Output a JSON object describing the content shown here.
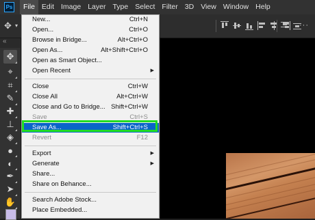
{
  "app": {
    "logo_text": "Ps"
  },
  "menubar": {
    "items": [
      "File",
      "Edit",
      "Image",
      "Layer",
      "Type",
      "Select",
      "Filter",
      "3D",
      "View",
      "Window",
      "Help"
    ]
  },
  "file_menu": {
    "groups": [
      [
        {
          "label": "New...",
          "shortcut": "Ctrl+N"
        },
        {
          "label": "Open...",
          "shortcut": "Ctrl+O"
        },
        {
          "label": "Browse in Bridge...",
          "shortcut": "Alt+Ctrl+O"
        },
        {
          "label": "Open As...",
          "shortcut": "Alt+Shift+Ctrl+O"
        },
        {
          "label": "Open as Smart Object...",
          "shortcut": ""
        },
        {
          "label": "Open Recent",
          "shortcut": "",
          "submenu": true
        }
      ],
      [
        {
          "label": "Close",
          "shortcut": "Ctrl+W"
        },
        {
          "label": "Close All",
          "shortcut": "Alt+Ctrl+W"
        },
        {
          "label": "Close and Go to Bridge...",
          "shortcut": "Shift+Ctrl+W"
        },
        {
          "label": "Save",
          "shortcut": "Ctrl+S",
          "disabled": true
        },
        {
          "label": "Save As...",
          "shortcut": "Shift+Ctrl+S",
          "highlighted": true
        },
        {
          "label": "Revert",
          "shortcut": "F12",
          "disabled": true
        }
      ],
      [
        {
          "label": "Export",
          "shortcut": "",
          "submenu": true
        },
        {
          "label": "Generate",
          "shortcut": "",
          "submenu": true
        },
        {
          "label": "Share...",
          "shortcut": ""
        },
        {
          "label": "Share on Behance...",
          "shortcut": ""
        }
      ],
      [
        {
          "label": "Search Adobe Stock...",
          "shortcut": ""
        },
        {
          "label": "Place Embedded...",
          "shortcut": ""
        }
      ]
    ]
  },
  "toolbar": {
    "tools": [
      "move-tool",
      "marquee-tool",
      "crop-tool",
      "eyedropper-tool",
      "healing-brush-tool",
      "clone-stamp-tool",
      "eraser-tool",
      "blur-tool",
      "dodge-tool",
      "pen-tool",
      "path-selection-tool",
      "hand-tool"
    ]
  },
  "colors": {
    "highlight": "#0a64c8",
    "annotation": "#22dd22",
    "foreground_swatch": "#c8bce8"
  }
}
